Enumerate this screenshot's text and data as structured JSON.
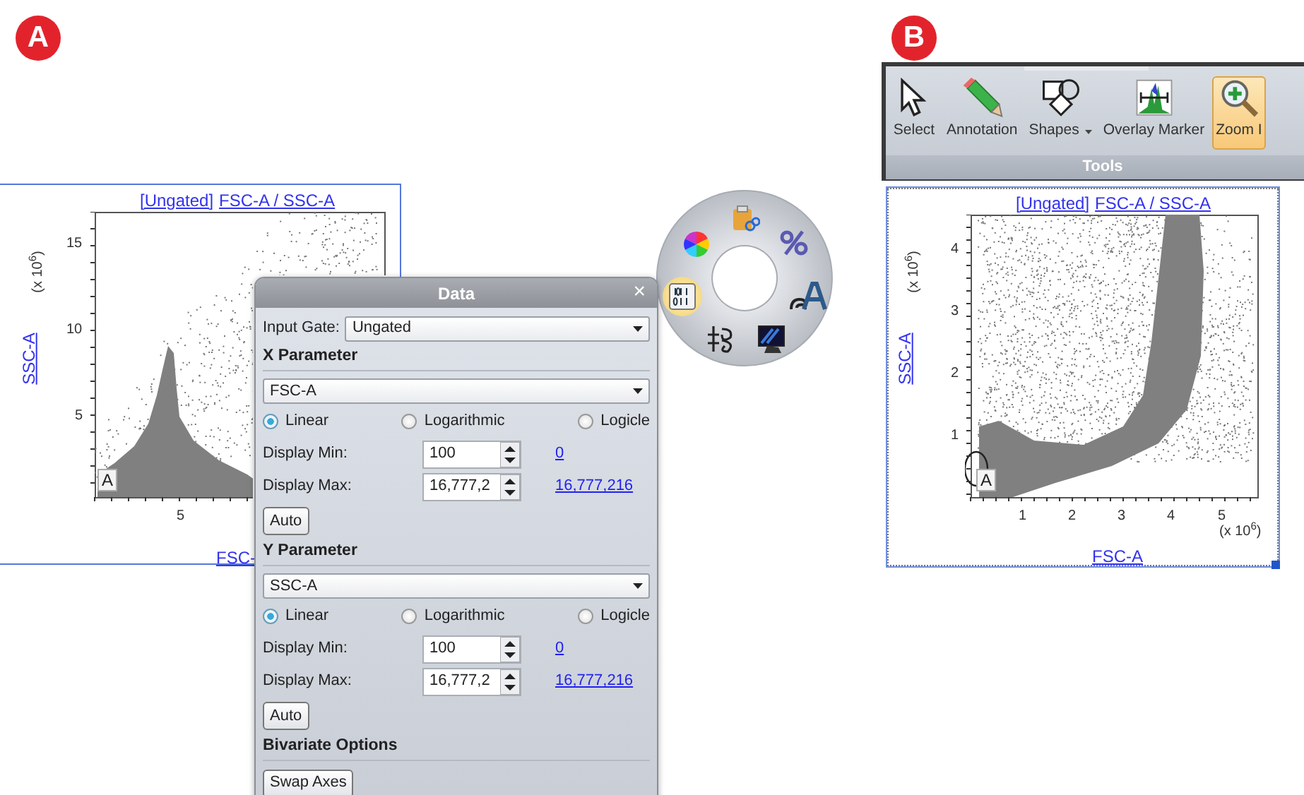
{
  "panel_a": {
    "label": "A",
    "plot": {
      "title_gate": "[Ungated]",
      "title_params": "FSC-A / SSC-A",
      "ylabel": "SSC-A",
      "xlabel": "FSC-",
      "y_exponent": "(x 10$^{6}$)",
      "yticks": [
        "15",
        "10",
        "5"
      ],
      "xticks": [
        "5"
      ],
      "gate": "A"
    },
    "dialog": {
      "title": "Data",
      "close": "×",
      "input_gate": {
        "label": "Input Gate:",
        "value": "Ungated"
      },
      "sections": [
        {
          "heading": "X Parameter",
          "parameter": "FSC-A",
          "scales": [
            {
              "label": "Linear",
              "selected": true
            },
            {
              "label": "Logarithmic",
              "selected": false
            },
            {
              "label": "Logicle",
              "selected": false
            }
          ],
          "min": {
            "label": "Display Min:",
            "value": "100",
            "link": "0"
          },
          "max": {
            "label": "Display Max:",
            "value": "16,777,2",
            "link": "16,777,216"
          },
          "auto": "Auto"
        },
        {
          "heading": "Y Parameter",
          "parameter": "SSC-A",
          "scales": [
            {
              "label": "Linear",
              "selected": true
            },
            {
              "label": "Logarithmic",
              "selected": false
            },
            {
              "label": "Logicle",
              "selected": false
            }
          ],
          "min": {
            "label": "Display Min:",
            "value": "100",
            "link": "0"
          },
          "max": {
            "label": "Display Max:",
            "value": "16,777,2",
            "link": "16,777,216"
          },
          "auto": "Auto"
        }
      ],
      "bivariate": {
        "heading": "Bivariate Options",
        "button": "Swap Axes"
      }
    },
    "radial_menu": {
      "items": [
        {
          "kind": "color-wheel",
          "selected": false
        },
        {
          "kind": "clipboard",
          "selected": false
        },
        {
          "kind": "percent",
          "selected": false
        },
        {
          "kind": "binary",
          "selected": true
        },
        {
          "kind": "font",
          "selected": false
        },
        {
          "kind": "signature",
          "selected": false
        },
        {
          "kind": "monitor",
          "selected": false
        }
      ]
    }
  },
  "panel_b": {
    "label": "B",
    "ribbon": {
      "buttons": [
        {
          "kind": "select",
          "label": "Select",
          "selected": false,
          "dropdown": false
        },
        {
          "kind": "annotation",
          "label": "Annotation",
          "selected": false,
          "dropdown": false
        },
        {
          "kind": "shapes",
          "label": "Shapes",
          "selected": false,
          "dropdown": true
        },
        {
          "kind": "overlay",
          "label": "Overlay Marker",
          "selected": false,
          "dropdown": false
        },
        {
          "kind": "zoom",
          "label": "Zoom I",
          "selected": true,
          "dropdown": false
        }
      ],
      "group_label": "Tools"
    },
    "plot": {
      "title_gate": "[Ungated]",
      "title_params": "FSC-A / SSC-A",
      "ylabel": "SSC-A",
      "xlabel": "FSC-A",
      "y_exponent": "(x 10$^{6}$)",
      "x_exponent": "(x 10$^{6}$)",
      "yticks": [
        "4",
        "3",
        "2",
        "1"
      ],
      "xticks": [
        "1",
        "2",
        "3",
        "4",
        "5"
      ],
      "gate": "A"
    }
  }
}
